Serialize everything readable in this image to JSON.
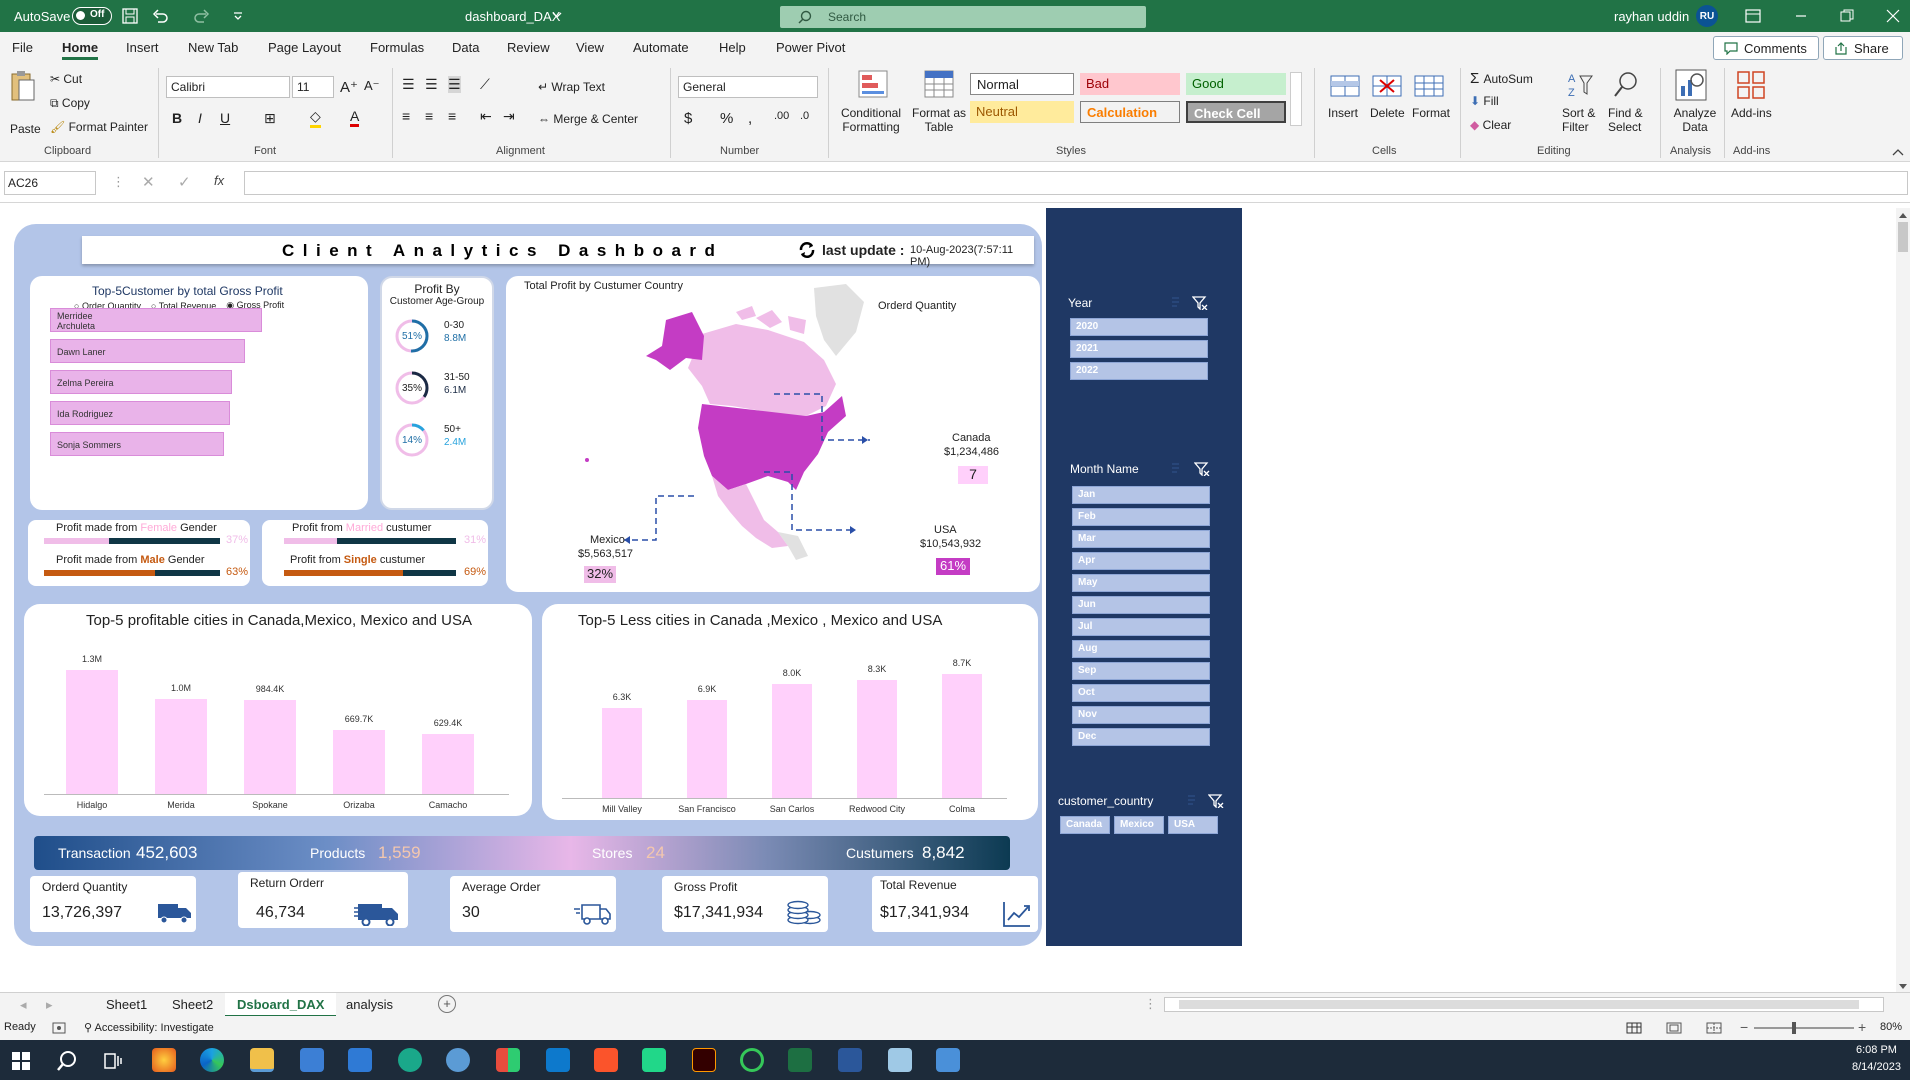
{
  "titlebar": {
    "autosave_label": "AutoSave",
    "autosave_state": "Off",
    "filename": "dashboard_DAX",
    "search_placeholder": "Search",
    "user_name": "rayhan uddin",
    "user_initials": "RU"
  },
  "ribbon_tabs": [
    "File",
    "Home",
    "Insert",
    "New Tab",
    "Page Layout",
    "Formulas",
    "Data",
    "Review",
    "View",
    "Automate",
    "Help",
    "Power Pivot"
  ],
  "active_tab": "Home",
  "top_buttons": {
    "comments": "Comments",
    "share": "Share"
  },
  "ribbon": {
    "clipboard": {
      "paste": "Paste",
      "cut": "Cut",
      "copy": "Copy",
      "format_painter": "Format Painter",
      "label": "Clipboard"
    },
    "font": {
      "name": "Calibri",
      "size": "11",
      "label": "Font"
    },
    "alignment": {
      "wrap_text": "Wrap Text",
      "merge_center": "Merge & Center",
      "label": "Alignment"
    },
    "number": {
      "format": "General",
      "label": "Number"
    },
    "styles": {
      "conditional": "Conditional Formatting",
      "format_table": "Format as Table",
      "cells": [
        "Normal",
        "Bad",
        "Good",
        "Neutral",
        "Calculation",
        "Check Cell"
      ],
      "label": "Styles"
    },
    "cells": {
      "insert": "Insert",
      "delete": "Delete",
      "format": "Format",
      "label": "Cells"
    },
    "editing": {
      "autosum": "AutoSum",
      "fill": "Fill",
      "clear": "Clear",
      "sort_filter": "Sort & Filter",
      "find_select": "Find & Select",
      "label": "Editing"
    },
    "analysis": {
      "analyze": "Analyze Data",
      "label": "Analysis"
    },
    "addins": {
      "addins": "Add-ins",
      "label": "Add-ins"
    }
  },
  "formula_bar": {
    "cell_ref": "AC26",
    "fx": "fx",
    "content": ""
  },
  "dashboard": {
    "title": "Client Analytics Dashboard",
    "last_update_label": "last update :",
    "last_update_value": "10-Aug-2023(7:57:11 PM)",
    "top_customers": {
      "title": "Top-5Customer by total Gross Profit",
      "options": [
        "Order Quantity",
        "Total Revenue",
        "Gross Profit"
      ],
      "selected_option": "Gross Profit",
      "chart_data": {
        "type": "bar",
        "orientation": "horizontal",
        "categories": [
          "Merridee Archuleta",
          "Dawn Laner",
          "Zelma Pereira",
          "Ida Rodriguez",
          "Sonja Sommers"
        ],
        "values": [
          1.0,
          0.92,
          0.86,
          0.85,
          0.82
        ]
      }
    },
    "age_group": {
      "title_line1": "Profit By",
      "title_line2": "Customer  Age-Group",
      "groups": [
        {
          "pct": "51%",
          "range": "0-30",
          "value": "8.8M",
          "fraction": 0.51,
          "color": "#1f6fa6"
        },
        {
          "pct": "35%",
          "range": "31-50",
          "value": "6.1M",
          "fraction": 0.35,
          "color": "#1a2a44"
        },
        {
          "pct": "14%",
          "range": "50+",
          "value": "2.4M",
          "fraction": 0.14,
          "color": "#27a3dd"
        }
      ]
    },
    "gender": {
      "female_prefix": "Profit made from ",
      "female_word": "Female",
      "female_suffix": " Gender",
      "female_pct": "37%",
      "female_fraction": 0.37,
      "male_prefix": "Profit made from ",
      "male_word": "Male",
      "male_suffix": " Gender",
      "male_pct": "63%",
      "male_fraction": 0.63
    },
    "marital": {
      "married_prefix": "Profit from ",
      "married_word": "Married",
      "married_suffix": " custumer",
      "married_pct": "31%",
      "married_fraction": 0.31,
      "single_prefix": "Profit from ",
      "single_word": "Single",
      "single_suffix": " custumer",
      "single_pct": "69%",
      "single_fraction": 0.69
    },
    "map": {
      "title": "Total Profit by Custumer Country",
      "legend": "Orderd Quantity",
      "countries": [
        {
          "name": "Canada",
          "profit": "$1,234,486",
          "qty": "7"
        },
        {
          "name": "Mexico",
          "profit": "$5,563,517",
          "qty": "32%"
        },
        {
          "name": "USA",
          "profit": "$10,543,932",
          "qty": "61%"
        }
      ]
    },
    "top_cities": {
      "title": "Top-5 profitable cities in Canada,Mexico,  Mexico and USA",
      "chart_data": {
        "type": "bar",
        "categories": [
          "Hidalgo",
          "Merida",
          "Spokane",
          "Orizaba",
          "Camacho"
        ],
        "values": [
          1300000,
          1000000,
          984400,
          669700,
          629400
        ],
        "labels": [
          "1.3M",
          "1.0M",
          "984.4K",
          "669.7K",
          "629.4K"
        ],
        "ylim": [
          0,
          1300000
        ]
      }
    },
    "less_cities": {
      "title": "Top-5 Less cities in Canada ,Mexico , Mexico and USA",
      "chart_data": {
        "type": "bar",
        "categories": [
          "Mill Valley",
          "San Francisco",
          "San Carlos",
          "Redwood City",
          "Colma"
        ],
        "values": [
          6300,
          6900,
          8000,
          8300,
          8700
        ],
        "labels": [
          "6.3K",
          "6.9K",
          "8.0K",
          "8.3K",
          "8.7K"
        ],
        "ylim": [
          0,
          8700
        ]
      }
    },
    "strip": {
      "transaction_label": "Transaction",
      "transaction_value": "452,603",
      "products_label": "Products",
      "products_value": "1,559",
      "stores_label": "Stores",
      "stores_value": "24",
      "customers_label": "Custumers",
      "customers_value": "8,842"
    },
    "kpis": [
      {
        "label": "Orderd Quantity",
        "value": "13,726,397",
        "icon": "truck-icon"
      },
      {
        "label": "Return Orderr",
        "value": "46,734",
        "icon": "delivery-truck-icon"
      },
      {
        "label": "Average Order",
        "value": "30",
        "icon": "fast-delivery-icon"
      },
      {
        "label": "Gross Profit",
        "value": "$17,341,934",
        "icon": "coins-icon"
      },
      {
        "label": "Total Revenue",
        "value": "$17,341,934",
        "icon": "line-chart-icon"
      }
    ]
  },
  "slicers": {
    "year": {
      "title": "Year",
      "items": [
        "2020",
        "2021",
        "2022"
      ]
    },
    "month": {
      "title": "Month Name",
      "items": [
        "Jan",
        "Feb",
        "Mar",
        "Apr",
        "May",
        "Jun",
        "Jul",
        "Aug",
        "Sep",
        "Oct",
        "Nov",
        "Dec"
      ]
    },
    "country": {
      "title": "customer_country",
      "items": [
        "Canada",
        "Mexico",
        "USA"
      ]
    }
  },
  "sheet_tabs": [
    "Sheet1",
    "Sheet2",
    "Dsboard_DAX",
    "analysis"
  ],
  "active_sheet": "Dsboard_DAX",
  "status": {
    "ready": "Ready",
    "accessibility": "Accessibility: Investigate",
    "zoom": "80%"
  },
  "taskbar": {
    "time": "6:08 PM",
    "date": "8/14/2023"
  },
  "colors": {
    "excel_green": "#217346",
    "slicer_bg": "#1f3864",
    "dash_bg": "#b3c5e8",
    "magenta": "#c43cc4",
    "bar_pink": "#ffd0fb"
  }
}
